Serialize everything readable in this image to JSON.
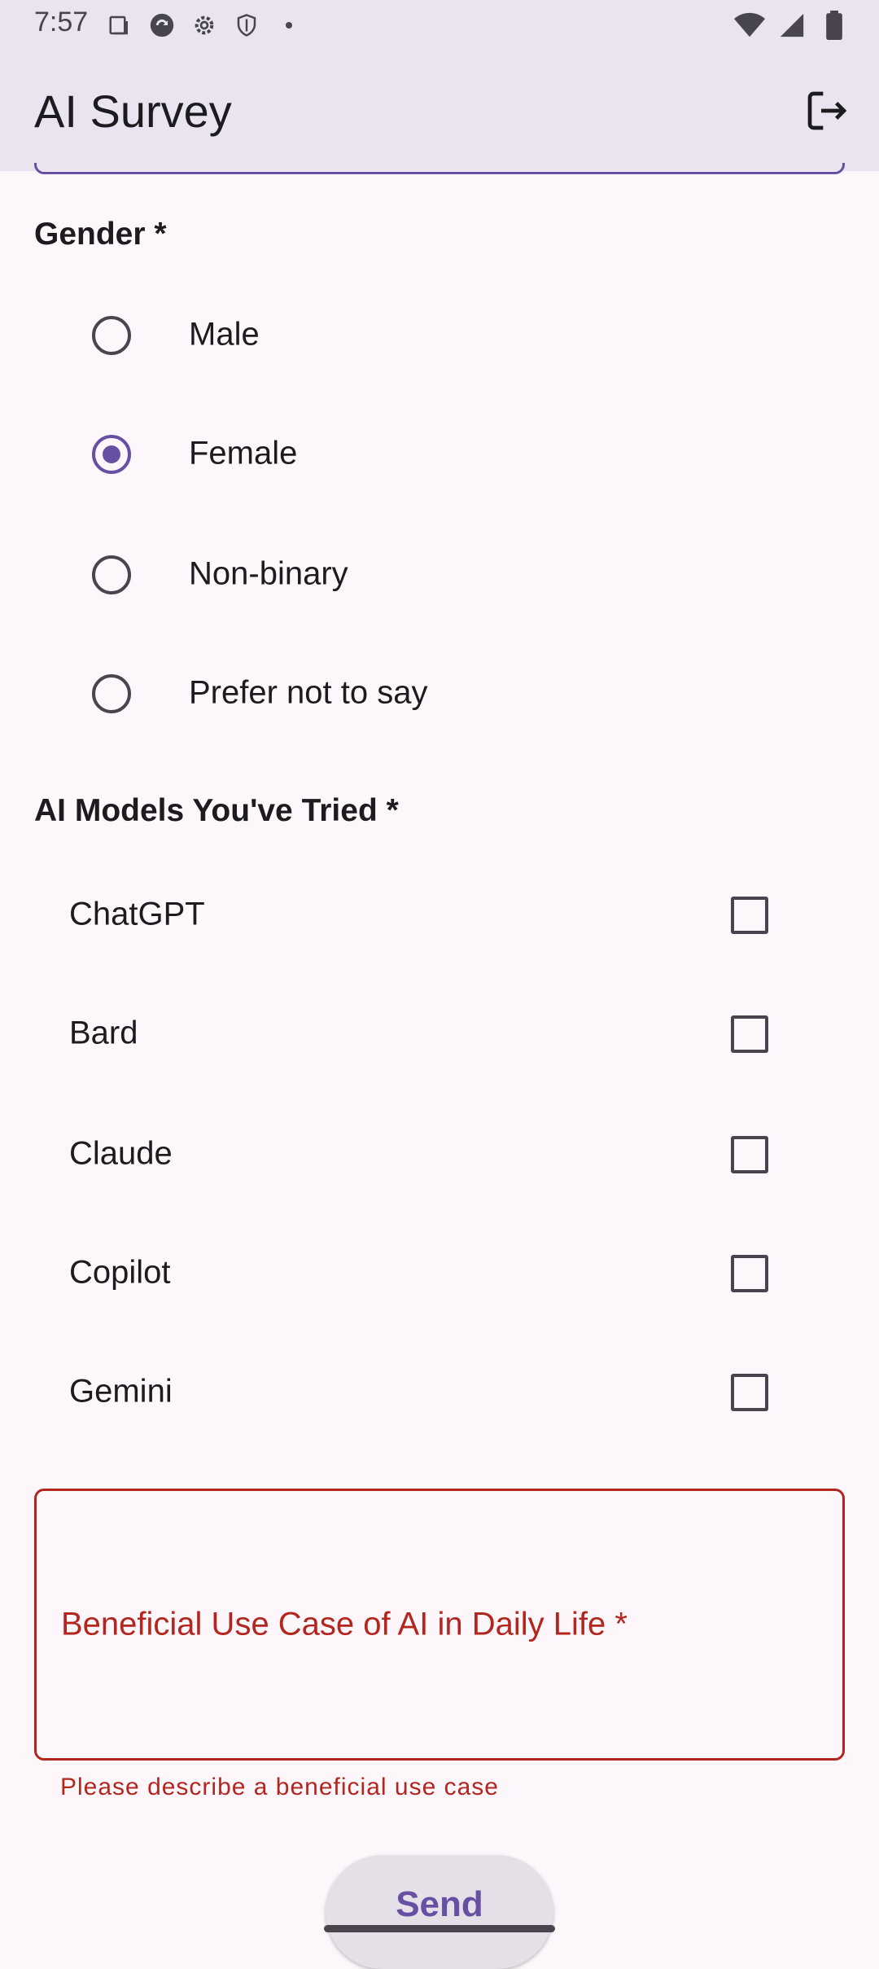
{
  "status_bar": {
    "time": "7:57",
    "left_icons": [
      "screenshot-icon",
      "sync-icon",
      "settings-icon",
      "shield-icon",
      "dot-icon"
    ],
    "right_icons": [
      "wifi-icon",
      "signal-icon",
      "battery-icon"
    ]
  },
  "app_bar": {
    "title": "AI Survey",
    "action_icon": "logout-icon"
  },
  "gender_section": {
    "title": "Gender *",
    "options": [
      {
        "label": "Male",
        "selected": false
      },
      {
        "label": "Female",
        "selected": true
      },
      {
        "label": "Non-binary",
        "selected": false
      },
      {
        "label": "Prefer not to say",
        "selected": false
      }
    ]
  },
  "models_section": {
    "title": "AI Models You've Tried *",
    "options": [
      {
        "label": "ChatGPT",
        "checked": false
      },
      {
        "label": "Bard",
        "checked": false
      },
      {
        "label": "Claude",
        "checked": false
      },
      {
        "label": "Copilot",
        "checked": false
      },
      {
        "label": "Gemini",
        "checked": false
      }
    ]
  },
  "use_case_field": {
    "label": "Beneficial Use Case of AI in Daily Life *",
    "value": "",
    "error": "Please describe a beneficial use case"
  },
  "send_button": {
    "label": "Send"
  },
  "colors": {
    "primary": "#6750A4",
    "error": "#B3261E",
    "app_bar_bg": "#E9E4EF",
    "page_bg": "#FDF7FC"
  }
}
